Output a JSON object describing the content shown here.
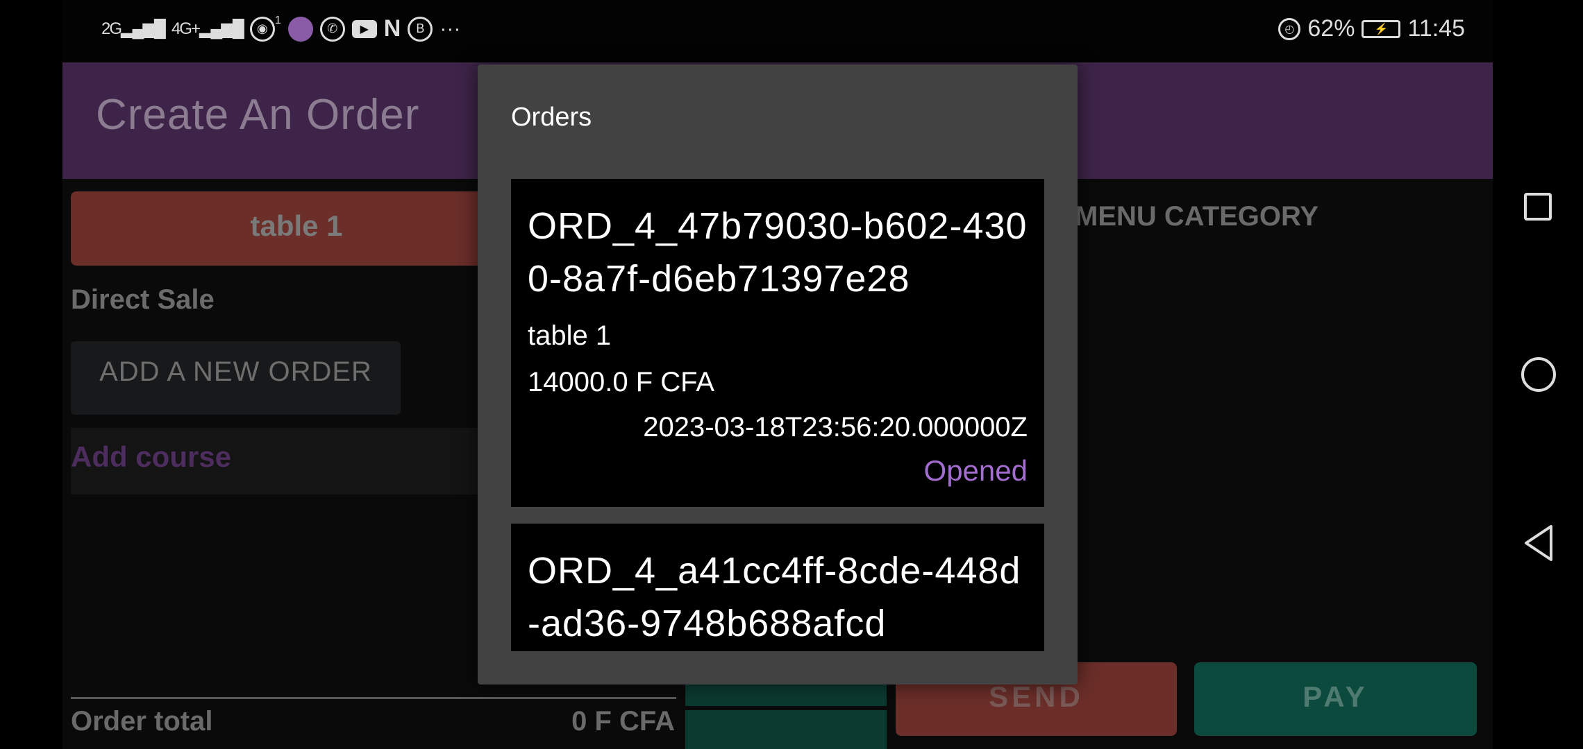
{
  "status_bar": {
    "network1": "2G",
    "network2": "4G+",
    "notif_count": "1",
    "battery": "62%",
    "time": "11:45",
    "icons": [
      "signal-icon",
      "hotspot-icon",
      "app-icon",
      "whatsapp-icon",
      "youtube-icon",
      "netflix-icon",
      "bold-b-icon",
      "more-icon",
      "alarm-icon",
      "battery-icon"
    ]
  },
  "header": {
    "title": "Create An Order"
  },
  "table_button": {
    "label": "table 1"
  },
  "section": {
    "direct_sale": "Direct Sale"
  },
  "add_order_button": {
    "label": "ADD A NEW ORDER"
  },
  "add_course": {
    "label": "Add course"
  },
  "menu_category": {
    "label": "MENU CATEGORY"
  },
  "order_total": {
    "label": "Order total",
    "value": "0 F CFA"
  },
  "actions": {
    "send_label": "SEND",
    "pay_label": "PAY"
  },
  "dialog": {
    "title": "Orders",
    "orders": [
      {
        "id": "ORD_4_47b79030-b602-4300-8a7f-d6eb71397e28",
        "table": "table 1",
        "total": "14000.0 F CFA",
        "date": "2023-03-18T23:56:20.000000Z",
        "status": "Opened"
      },
      {
        "id": "ORD_4_a41cc4ff-8cde-448d-ad36-9748b688afcd"
      }
    ]
  },
  "colors": {
    "header_bg": "#3d2448",
    "status_opened": "#a36ccf",
    "dialog_bg": "#424242",
    "send_bg": "#6b2e29",
    "pay_bg": "#0b4a3d"
  }
}
